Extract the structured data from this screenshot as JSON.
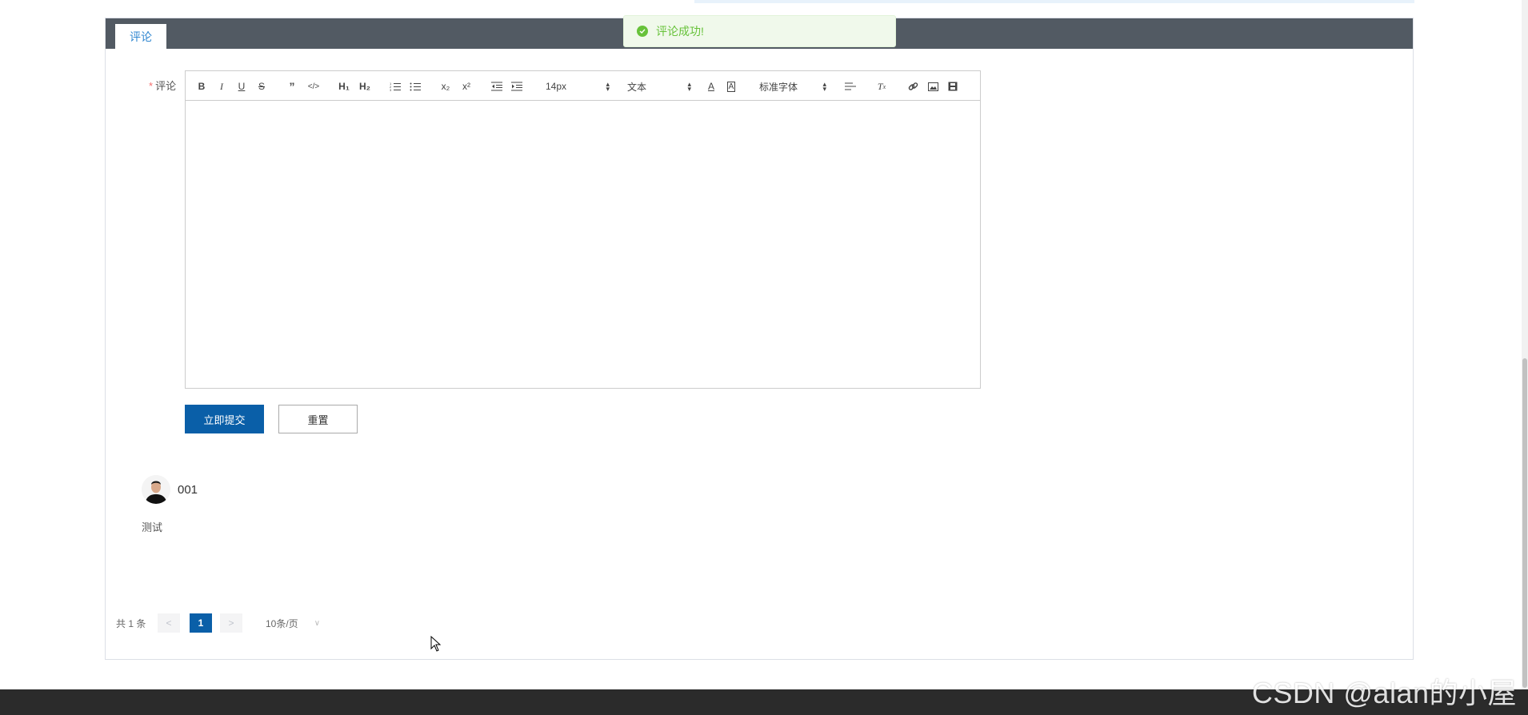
{
  "tab": {
    "label": "评论"
  },
  "toast": {
    "message": "评论成功!"
  },
  "form": {
    "label": "评论",
    "required_mark": "*"
  },
  "toolbar": {
    "size_value": "14px",
    "header_value": "文本",
    "font_value": "标准字体",
    "h1": "H₁",
    "h2": "H₂",
    "sub": "x₂",
    "sup": "x²"
  },
  "buttons": {
    "submit": "立即提交",
    "reset": "重置"
  },
  "comment": {
    "username": "001",
    "text": "测试"
  },
  "pagination": {
    "total": "共 1 条",
    "prev": "<",
    "current": "1",
    "next": ">",
    "page_size": "10条/页"
  },
  "watermark": "CSDN @alan的小屋",
  "colors": {
    "primary": "#0a5fa8",
    "success": "#67c23a",
    "tabbar": "#525a63",
    "footer": "#2b2b2b"
  }
}
